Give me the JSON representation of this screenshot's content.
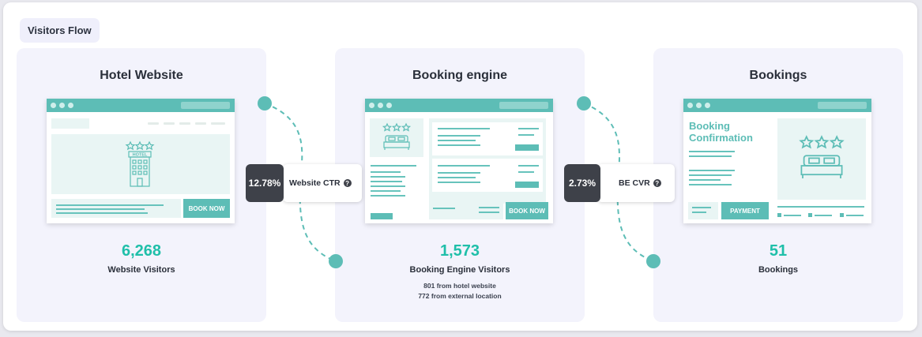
{
  "header": {
    "tag": "Visitors Flow"
  },
  "panels": [
    {
      "title": "Hotel Website",
      "screen_text": "HOTEL",
      "button_label": "BOOK NOW",
      "value": "6,268",
      "label": "Website Visitors"
    },
    {
      "title": "Booking engine",
      "button_label": "BOOK NOW",
      "value": "1,573",
      "label": "Booking Engine Visitors",
      "notes": [
        "801 from hotel website",
        "772 from external location"
      ]
    },
    {
      "title": "Bookings",
      "screen_title": "Booking Confirmation",
      "button_label": "PAYMENT",
      "value": "51",
      "label": "Bookings"
    }
  ],
  "connectors": [
    {
      "percent": "12.78%",
      "label": "Website CTR"
    },
    {
      "percent": "2.73%",
      "label": "BE CVR"
    }
  ],
  "icons": {
    "help": "question-circle-icon",
    "hotel": "hotel-building-icon",
    "bed": "bed-icon",
    "stars": "three-stars-icon"
  },
  "colors": {
    "accent": "#5dbdb6",
    "number": "#1fbfa9",
    "dark": "#3e4149",
    "panel_bg": "#f3f3fc"
  }
}
